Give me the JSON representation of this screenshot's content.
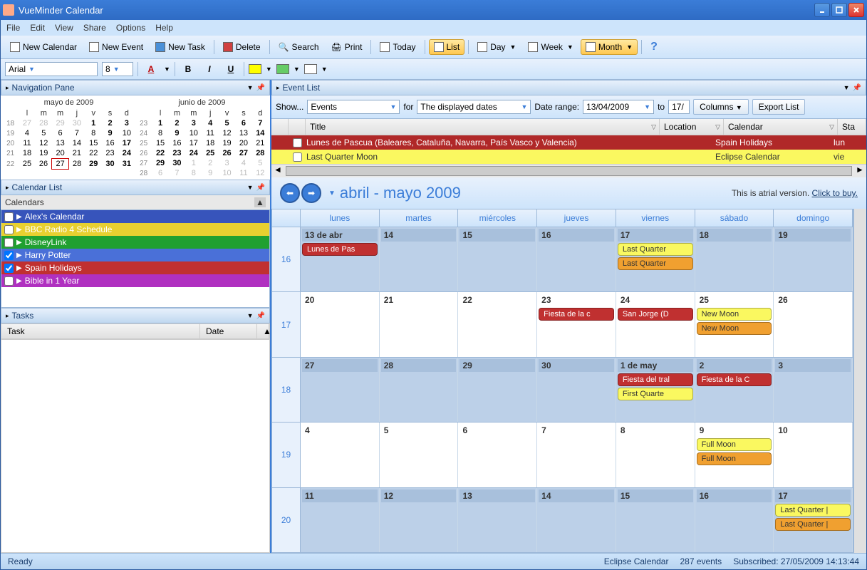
{
  "window": {
    "title": "VueMinder Calendar"
  },
  "menu": {
    "file": "File",
    "edit": "Edit",
    "view": "View",
    "share": "Share",
    "options": "Options",
    "help": "Help"
  },
  "toolbar": {
    "new_calendar": "New Calendar",
    "new_event": "New Event",
    "new_task": "New Task",
    "delete": "Delete",
    "search": "Search",
    "print": "Print",
    "today": "Today",
    "list": "List",
    "day": "Day",
    "week": "Week",
    "month": "Month"
  },
  "format": {
    "font": "Arial",
    "size": "8"
  },
  "nav_pane": {
    "title": "Navigation Pane"
  },
  "minical1": {
    "header": "mayo de 2009",
    "dow": [
      "l",
      "m",
      "m",
      "j",
      "v",
      "s",
      "d"
    ],
    "weeks": [
      {
        "wk": "18",
        "days": [
          "27",
          "28",
          "29",
          "30",
          "1",
          "2",
          "3"
        ],
        "bold": [
          4,
          5,
          6
        ],
        "dim": [
          0,
          1,
          2,
          3
        ]
      },
      {
        "wk": "19",
        "days": [
          "4",
          "5",
          "6",
          "7",
          "8",
          "9",
          "10"
        ],
        "bold": [
          5
        ]
      },
      {
        "wk": "20",
        "days": [
          "11",
          "12",
          "13",
          "14",
          "15",
          "16",
          "17"
        ],
        "bold": [
          6
        ]
      },
      {
        "wk": "21",
        "days": [
          "18",
          "19",
          "20",
          "21",
          "22",
          "23",
          "24"
        ],
        "bold": [
          6
        ]
      },
      {
        "wk": "22",
        "days": [
          "25",
          "26",
          "27",
          "28",
          "29",
          "30",
          "31"
        ],
        "bold": [
          4,
          5,
          6
        ],
        "sel": 2
      }
    ]
  },
  "minical2": {
    "header": "junio de 2009",
    "dow": [
      "l",
      "m",
      "m",
      "j",
      "v",
      "s",
      "d"
    ],
    "weeks": [
      {
        "wk": "23",
        "days": [
          "1",
          "2",
          "3",
          "4",
          "5",
          "6",
          "7"
        ],
        "bold": [
          0,
          1,
          2,
          3,
          4,
          5,
          6
        ]
      },
      {
        "wk": "24",
        "days": [
          "8",
          "9",
          "10",
          "11",
          "12",
          "13",
          "14"
        ],
        "bold": [
          1,
          6
        ]
      },
      {
        "wk": "25",
        "days": [
          "15",
          "16",
          "17",
          "18",
          "19",
          "20",
          "21"
        ],
        "bold": []
      },
      {
        "wk": "26",
        "days": [
          "22",
          "23",
          "24",
          "25",
          "26",
          "27",
          "28"
        ],
        "bold": [
          0,
          1,
          2,
          3,
          4,
          5,
          6
        ]
      },
      {
        "wk": "27",
        "days": [
          "29",
          "30",
          "1",
          "2",
          "3",
          "4",
          "5"
        ],
        "bold": [
          0,
          1
        ],
        "dim": [
          2,
          3,
          4,
          5,
          6
        ]
      },
      {
        "wk": "28",
        "days": [
          "6",
          "7",
          "8",
          "9",
          "10",
          "11",
          "12"
        ],
        "dim": [
          0,
          1,
          2,
          3,
          4,
          5,
          6
        ]
      }
    ]
  },
  "calendar_list": {
    "title": "Calendar List",
    "header": "Calendars",
    "items": [
      {
        "label": "Alex's Calendar",
        "color": "#3754bb",
        "checked": false
      },
      {
        "label": "BBC Radio 4 Schedule",
        "color": "#e8d030",
        "checked": false
      },
      {
        "label": "DisneyLink",
        "color": "#20a030",
        "checked": false
      },
      {
        "label": "Harry Potter",
        "color": "#4a70d8",
        "checked": true
      },
      {
        "label": "Spain Holidays",
        "color": "#c03030",
        "checked": true
      },
      {
        "label": "Bible in 1 Year",
        "color": "#b030c0",
        "checked": false
      }
    ]
  },
  "tasks": {
    "title": "Tasks",
    "col_task": "Task",
    "col_date": "Date"
  },
  "event_list": {
    "title": "Event List",
    "show": "Show...",
    "events": "Events",
    "for": "for",
    "displayed": "The displayed dates",
    "date_range": "Date range:",
    "from": "13/04/2009",
    "to": "to",
    "to_date": "17/",
    "columns": "Columns",
    "export": "Export List",
    "col_title": "Title",
    "col_location": "Location",
    "col_calendar": "Calendar",
    "col_start": "Sta",
    "rows": [
      {
        "title": "Lunes de Pascua (Baleares, Cataluña, Navarra, País Vasco y Valencia)",
        "calendar": "Spain Holidays",
        "start": "lun",
        "cls": "red"
      },
      {
        "title": "Last Quarter Moon",
        "calendar": "Eclipse Calendar",
        "start": "vie",
        "cls": "yellow"
      }
    ]
  },
  "main_cal": {
    "period": "abril - mayo 2009",
    "trial_text": "This is atrial version.",
    "trial_link": "Click to buy.",
    "dow": [
      "lunes",
      "martes",
      "miércoles",
      "jueves",
      "viernes",
      "sábado",
      "domingo"
    ],
    "weeks": [
      {
        "wk": "16",
        "days": [
          {
            "n": "13 de abr",
            "shade": true,
            "ev": [
              {
                "t": "Lunes de Pas",
                "c": "red"
              }
            ]
          },
          {
            "n": "14",
            "shade": true
          },
          {
            "n": "15",
            "shade": true
          },
          {
            "n": "16",
            "shade": true
          },
          {
            "n": "17",
            "shade": true,
            "ev": [
              {
                "t": "Last Quarter",
                "c": "yellow"
              },
              {
                "t": "Last Quarter",
                "c": "orange"
              }
            ]
          },
          {
            "n": "18",
            "shade": true
          },
          {
            "n": "19",
            "shade": true
          }
        ]
      },
      {
        "wk": "17",
        "days": [
          {
            "n": "20"
          },
          {
            "n": "21"
          },
          {
            "n": "22"
          },
          {
            "n": "23",
            "ev": [
              {
                "t": "Fiesta de la c",
                "c": "red"
              }
            ]
          },
          {
            "n": "24",
            "ev": [
              {
                "t": "San Jorge (D",
                "c": "red"
              }
            ]
          },
          {
            "n": "25",
            "ev": [
              {
                "t": "New Moon",
                "c": "yellow"
              },
              {
                "t": "New Moon",
                "c": "orange"
              }
            ]
          },
          {
            "n": "26"
          }
        ]
      },
      {
        "wk": "18",
        "days": [
          {
            "n": "27",
            "shade": true
          },
          {
            "n": "28",
            "shade": true
          },
          {
            "n": "29",
            "shade": true
          },
          {
            "n": "30",
            "shade": true
          },
          {
            "n": "1 de may",
            "shade": true,
            "ev": [
              {
                "t": "Fiesta del tral",
                "c": "red"
              },
              {
                "t": "First Quarte",
                "c": "yellow"
              }
            ]
          },
          {
            "n": "2",
            "shade": true,
            "ev": [
              {
                "t": "Fiesta de la C",
                "c": "red"
              }
            ]
          },
          {
            "n": "3",
            "shade": true
          }
        ]
      },
      {
        "wk": "19",
        "days": [
          {
            "n": "4"
          },
          {
            "n": "5"
          },
          {
            "n": "6"
          },
          {
            "n": "7"
          },
          {
            "n": "8"
          },
          {
            "n": "9",
            "ev": [
              {
                "t": "Full Moon",
                "c": "yellow"
              },
              {
                "t": "Full Moon",
                "c": "orange"
              }
            ]
          },
          {
            "n": "10"
          }
        ]
      },
      {
        "wk": "20",
        "days": [
          {
            "n": "11",
            "shade": true
          },
          {
            "n": "12",
            "shade": true
          },
          {
            "n": "13",
            "shade": true
          },
          {
            "n": "14",
            "shade": true
          },
          {
            "n": "15",
            "shade": true
          },
          {
            "n": "16",
            "shade": true
          },
          {
            "n": "17",
            "shade": true,
            "ev": [
              {
                "t": "Last Quarter |",
                "c": "yellow"
              },
              {
                "t": "Last Quarter |",
                "c": "orange"
              }
            ]
          }
        ]
      }
    ]
  },
  "status": {
    "ready": "Ready",
    "cal": "Eclipse Calendar",
    "count": "287 events",
    "sub": "Subscribed: 27/05/2009 14:13:44"
  }
}
